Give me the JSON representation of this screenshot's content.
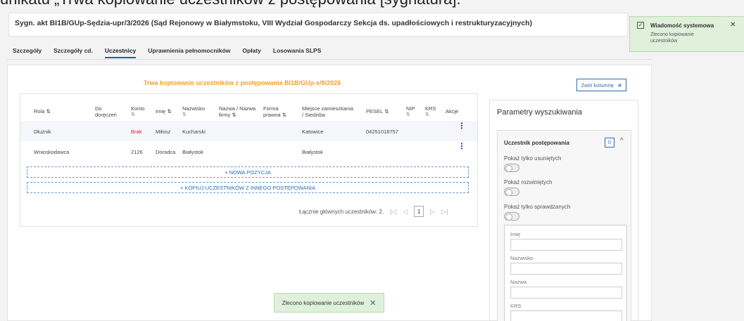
{
  "caption": "unikatu „Trwa kopiowanie uczestników z postępowania [sygnatura].”",
  "case": {
    "title": "Sygn. akt BI1B/GUp-Sędzia-upr/3/2026 (Sąd Rejonowy w Białymstoku, VIII Wydział Gospodarczy Sekcja ds. upadłościowych i restrukturyzacyjnych)"
  },
  "tabs": [
    "Szczegóły",
    "Szczegóły cd.",
    "Uczestnicy",
    "Uprawnienia pełnomocników",
    "Opłaty",
    "Losowania SLPS"
  ],
  "active_tab": "Uczestnicy",
  "copy_status": "Trwa kopiowanie uczestników z postępowania BI1B/GUp-s/8/2026",
  "collapse": {
    "label": "Zwiń kolumnę",
    "icon": "«"
  },
  "table": {
    "headers": {
      "rola": "Rola ⇅",
      "doreczen_1": "Do",
      "doreczen_2": "doręczeń",
      "konto_1": "Konto",
      "konto_2": "⇅",
      "imie": "Imię ⇅",
      "nazwisko_1": "Nazwisko",
      "nazwisko_2": "⇅",
      "nazwa_1": "Nazwa / Nazwa",
      "nazwa_2": "firmy ⇅",
      "forma_1": "Forma",
      "forma_2": "prawna ⇅",
      "miejsce_1": "Miejsce zamieszkania",
      "miejsce_2": "/ Siedziba",
      "pesel": "PESEL ⇅",
      "nip_1": "NIP",
      "nip_2": "⇅",
      "krs_1": "KRS",
      "krs_2": "⇅",
      "akcje": "Akcje"
    },
    "rows": [
      {
        "rola": "Dłużnik",
        "konto": "Brak",
        "imie": "Miłosz",
        "nazwisko": "Kucharski",
        "miejsce": "Katowice",
        "pesel": "04251018757"
      },
      {
        "rola": "Wnioskodawca",
        "konto": "2126",
        "imie": "Doradca",
        "nazwisko": "Białystok",
        "miejsce": "Białystok",
        "pesel": ""
      }
    ],
    "actions_icon": "⋮",
    "new_position": "+ NOWA POZYCJA",
    "copy_participants": "+ KOPIUJ UCZESTNIKÓW Z INNEGO POSTĘPOWANIA",
    "total_label": "Łącznie głównych uczestników: 2.",
    "page": "1",
    "pager": {
      "first": "|◁",
      "prev": "◁",
      "next": "▷",
      "last": "▷|"
    }
  },
  "search_panel": {
    "title": "Parametry wyszukiwania",
    "section_title": "Uczestnik postępowania",
    "badge": "0",
    "caret": "^",
    "options": [
      "Pokaż tylko usuniętych",
      "Pokaż rozwiniętych",
      "Pokaż tylko sprawdzanych"
    ],
    "fields": [
      "Imię",
      "Nazwisko",
      "Nazwa",
      "KRS"
    ]
  },
  "system_message": {
    "check": "✓",
    "title": "Wiadomość systemowa",
    "text": "Zlecono kopiowanie uczestników",
    "close": "✕"
  },
  "toast": {
    "text": "Zlecono kopiowanie uczestników",
    "close": "✕"
  }
}
